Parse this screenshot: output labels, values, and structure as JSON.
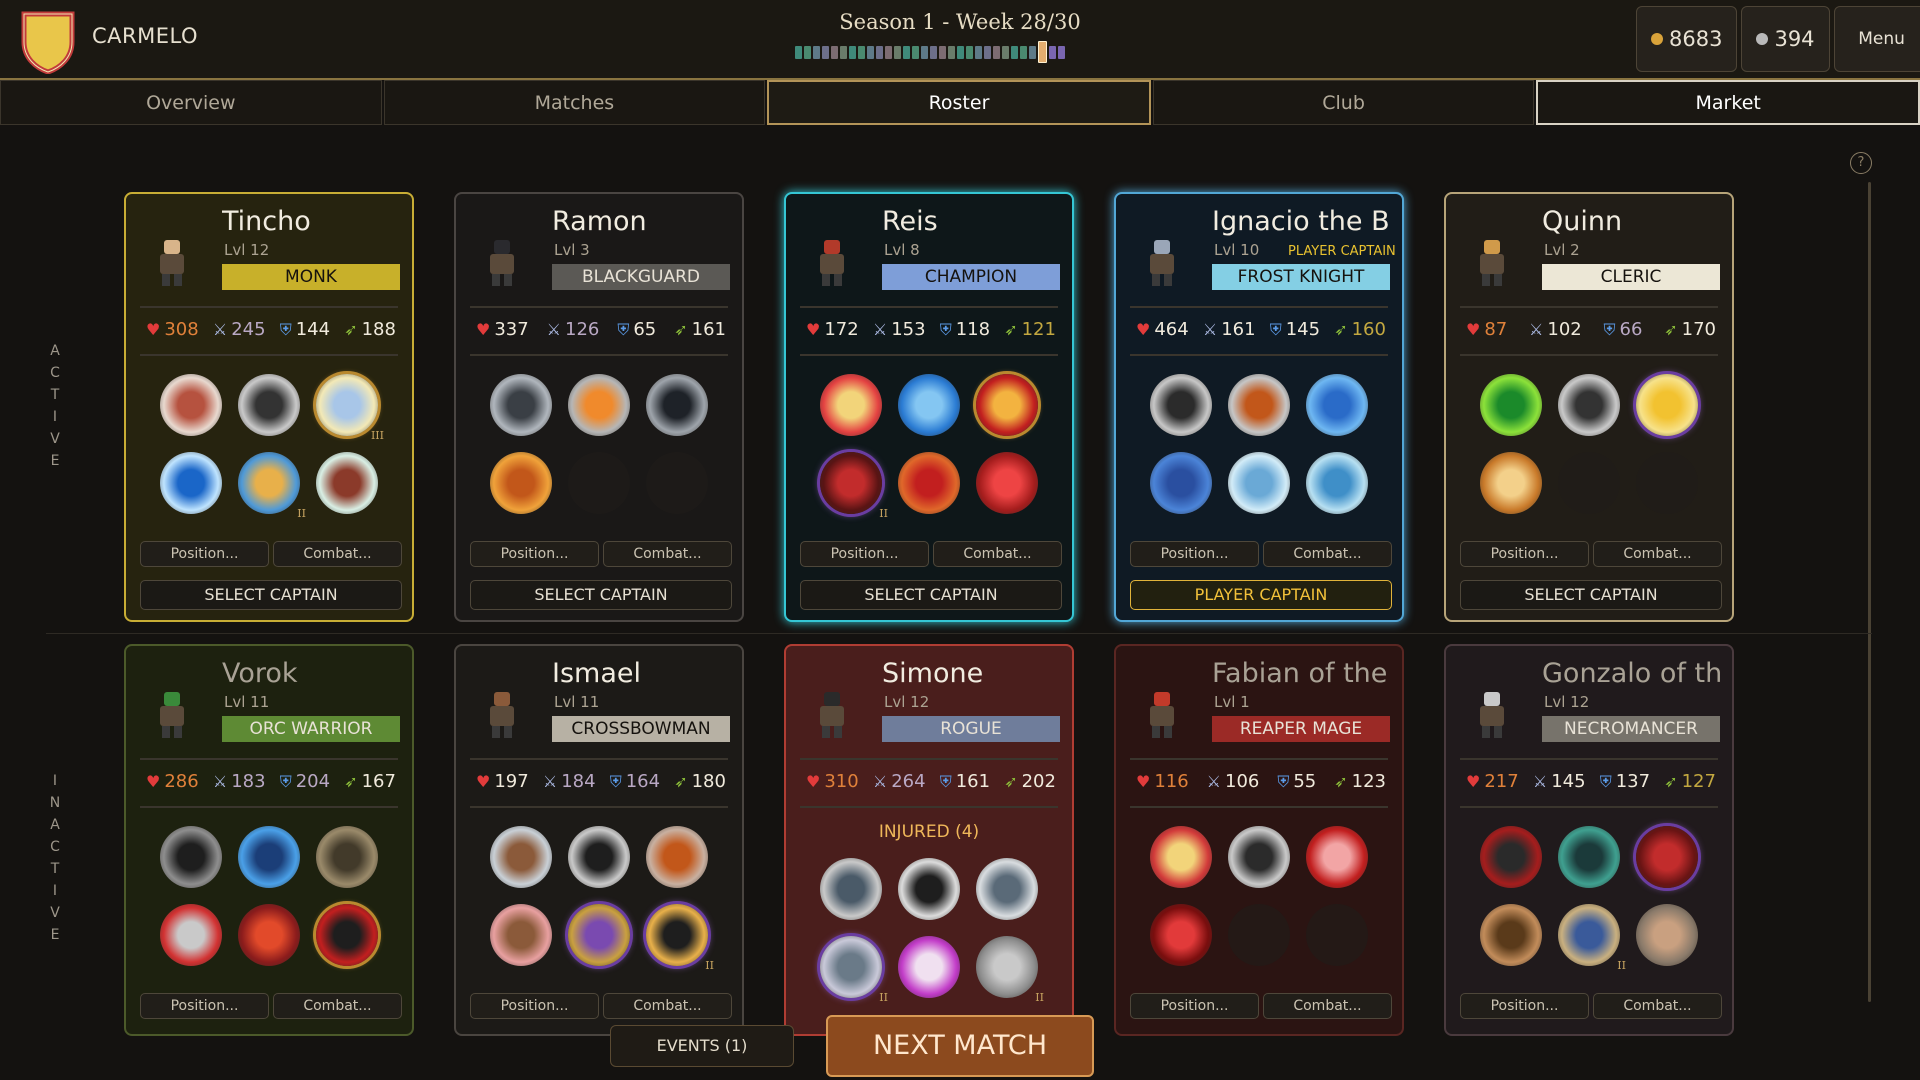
{
  "header": {
    "club_name": "CARMELO",
    "season_label": "Season 1 - Week 28/30",
    "coins": "8683",
    "gems": "394",
    "menu_label": "Menu",
    "crest_color": "#e9c64a",
    "crest_border": "#c23b3b"
  },
  "tabs": [
    {
      "label": "Overview"
    },
    {
      "label": "Matches"
    },
    {
      "label": "Roster"
    },
    {
      "label": "Club"
    },
    {
      "label": "Market"
    }
  ],
  "sections": {
    "active_label": "ACTIVE",
    "inactive_label": "INACTIVE"
  },
  "buttons": {
    "position": "Position...",
    "combat": "Combat...",
    "select_captain": "SELECT CAPTAIN",
    "player_captain": "PLAYER CAPTAIN",
    "help": "?",
    "events": "EVENTS (1)",
    "next_match": "NEXT MATCH"
  },
  "active_players": [
    {
      "name": "Tincho",
      "level": "Lvl 12",
      "class": "MONK",
      "class_color": "#c8b02a",
      "hp": "308",
      "atk": "245",
      "def": "144",
      "spd": "188",
      "captain": "SELECT CAPTAIN"
    },
    {
      "name": "Ramon",
      "level": "Lvl 3",
      "class": "BLACKGUARD",
      "class_color": "#5b5955",
      "hp": "337",
      "atk": "126",
      "def": "65",
      "spd": "161",
      "captain": "SELECT CAPTAIN"
    },
    {
      "name": "Reis",
      "level": "Lvl 8",
      "class": "CHAMPION",
      "class_color": "#7e9ed8",
      "hp": "172",
      "atk": "153",
      "def": "118",
      "spd": "121",
      "captain": "SELECT CAPTAIN"
    },
    {
      "name": "Ignacio the B...",
      "level": "Lvl 10",
      "tag": "PLAYER CAPTAIN",
      "class": "FROST KNIGHT",
      "class_color": "#84cfe4",
      "hp": "464",
      "atk": "161",
      "def": "145",
      "spd": "160",
      "captain": "PLAYER CAPTAIN"
    },
    {
      "name": "Quinn",
      "level": "Lvl 2",
      "class": "CLERIC",
      "class_color": "#ece7d6",
      "hp": "87",
      "atk": "102",
      "def": "66",
      "spd": "170",
      "captain": "SELECT CAPTAIN"
    }
  ],
  "inactive_players": [
    {
      "name": "Vorok",
      "level": "Lvl 11",
      "class": "ORC WARRIOR",
      "class_color": "#5e8a34",
      "hp": "286",
      "atk": "183",
      "def": "204",
      "spd": "167"
    },
    {
      "name": "Ismael",
      "level": "Lvl 11",
      "class": "CROSSBOWMAN",
      "class_color": "#b7b1a4",
      "hp": "197",
      "atk": "184",
      "def": "164",
      "spd": "180"
    },
    {
      "name": "Simone",
      "level": "Lvl 12",
      "class": "ROGUE",
      "class_color": "#6f7d9b",
      "hp": "310",
      "atk": "264",
      "def": "161",
      "spd": "202",
      "status": "INJURED (4)"
    },
    {
      "name": "Fabian of the ...",
      "level": "Lvl 1",
      "class": "REAPER MAGE",
      "class_color": "#9b2a26",
      "hp": "116",
      "atk": "106",
      "def": "55",
      "spd": "123"
    },
    {
      "name": "Gonzalo of th...",
      "level": "Lvl 12",
      "class": "NECROMANCER",
      "class_color": "#77736b",
      "hp": "217",
      "atk": "145",
      "def": "137",
      "spd": "127"
    }
  ],
  "rank_marks": [
    "III",
    "II"
  ]
}
